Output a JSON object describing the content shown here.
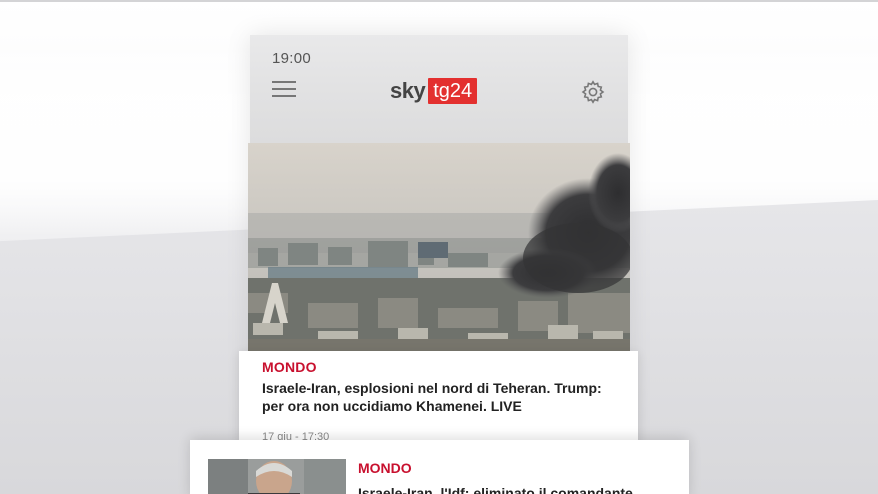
{
  "status_bar": {
    "time": "19:00"
  },
  "header": {
    "logo_sky": "sky",
    "logo_tg": "tg24",
    "menu_icon": "hamburger-menu-icon",
    "settings_icon": "gear-icon"
  },
  "articles": [
    {
      "category": "MONDO",
      "headline": "Israele-Iran, esplosioni nel nord di Teheran. Trump:  per ora non uccidiamo Khamenei. LIVE",
      "timestamp": "17 giu - 17:30"
    },
    {
      "category": "MONDO",
      "headline": "Israele-Iran, l'Idf: eliminato il comandante"
    }
  ],
  "colors": {
    "accent": "#c8102e",
    "logo_red": "#e3302f"
  }
}
